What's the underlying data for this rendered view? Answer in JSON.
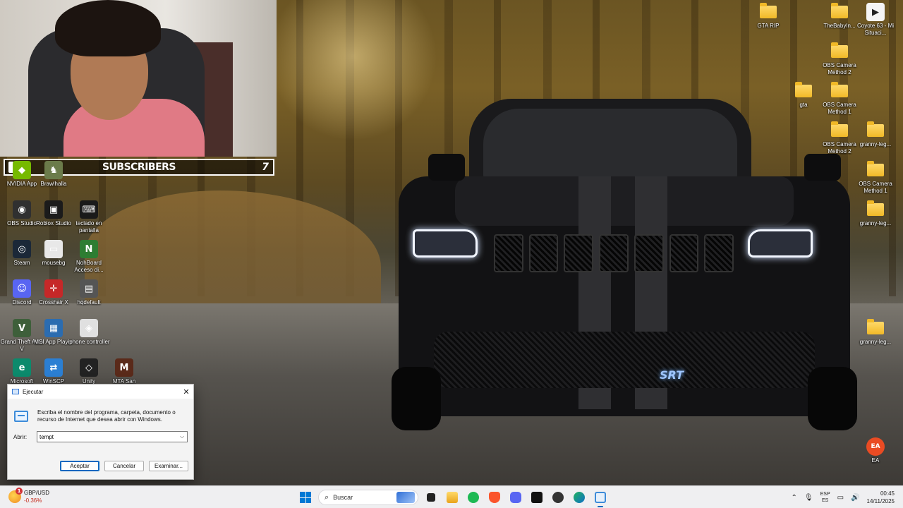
{
  "stream": {
    "subscribers_label": "SUBSCRIBERS",
    "subscribers_count": "7"
  },
  "desktop_left": [
    {
      "name": "nvidia-app",
      "label": "NVIDIA App",
      "color": "#76b900",
      "glyph": "◆"
    },
    {
      "name": "brawlhalla",
      "label": "Brawlhalla",
      "color": "#6b7b4a",
      "glyph": "♞"
    },
    {
      "name": "obs-studio",
      "label": "OBS Studio",
      "color": "#303030",
      "glyph": "◉"
    },
    {
      "name": "roblox-studio",
      "label": "Roblox Studio",
      "color": "#1b1b1b",
      "glyph": "▣"
    },
    {
      "name": "teclado-en-pantalla",
      "label": "teclado en pantalla",
      "color": "#1a1a1a",
      "glyph": "⌨"
    },
    {
      "name": "steam",
      "label": "Steam",
      "color": "#1b2838",
      "glyph": "◎"
    },
    {
      "name": "mousebg",
      "label": "mousebg",
      "color": "#e8e8e8",
      "glyph": "▭"
    },
    {
      "name": "nohboard",
      "label": "NohBoard Acceso di...",
      "color": "#2e7d32",
      "glyph": "N"
    },
    {
      "name": "discord",
      "label": "Discord",
      "color": "#5865f2",
      "glyph": "☺"
    },
    {
      "name": "crosshair-x",
      "label": "Crosshair X",
      "color": "#c62828",
      "glyph": "✛"
    },
    {
      "name": "hqdefault",
      "label": "hqdefault",
      "color": "#555",
      "glyph": "▤"
    },
    {
      "name": "grand-theft-auto-v",
      "label": "Grand Theft Auto V",
      "color": "#3e5f3a",
      "glyph": "V"
    },
    {
      "name": "msi-app-player",
      "label": "MSI App Player",
      "color": "#2b6cb0",
      "glyph": "▦"
    },
    {
      "name": "iphone-controller",
      "label": "iphone controller",
      "color": "#e0e0e0",
      "glyph": "◈"
    },
    {
      "name": "microsoft-edge",
      "label": "Microsoft",
      "color": "#0c8a6c",
      "glyph": "e"
    },
    {
      "name": "winscp",
      "label": "WinSCP",
      "color": "#2b7fd3",
      "glyph": "⇄"
    },
    {
      "name": "unity",
      "label": "Unity",
      "color": "#222",
      "glyph": "◇"
    },
    {
      "name": "mta-san",
      "label": "MTA San",
      "color": "#5a2a1a",
      "glyph": "M"
    }
  ],
  "desktop_right": [
    {
      "name": "gta-rip",
      "label": "GTA RIP",
      "type": "folder"
    },
    {
      "name": "thebabyin",
      "label": "TheBabyIn...",
      "type": "folder"
    },
    {
      "name": "coyote-63",
      "label": "Coyote 63 - Mi Situaci...",
      "type": "media"
    },
    {
      "name": "obs-camera-method-2-a",
      "label": "OBS Camera Method 2",
      "type": "folder"
    },
    {
      "name": "gta",
      "label": "gta",
      "type": "folder"
    },
    {
      "name": "obs-camera-method-1-a",
      "label": "OBS Camera Method 1",
      "type": "folder"
    },
    {
      "name": "obs-camera-method-2-b",
      "label": "OBS Camera Method 2",
      "type": "folder"
    },
    {
      "name": "granny-leg-1",
      "label": "granny-leg...",
      "type": "folder"
    },
    {
      "name": "obs-camera-method-1-b",
      "label": "OBS Camera Method 1",
      "type": "folder"
    },
    {
      "name": "granny-leg-2",
      "label": "granny-leg...",
      "type": "folder"
    },
    {
      "name": "granny-leg-3",
      "label": "granny-leg...",
      "type": "folder"
    },
    {
      "name": "ea",
      "label": "EA",
      "type": "ea"
    }
  ],
  "run_dialog": {
    "title": "Ejecutar",
    "description": "Escriba el nombre del programa, carpeta, documento o recurso de Internet que desea abrir con Windows.",
    "open_label": "Abrir:",
    "input_value": "tempt",
    "ok_label": "Aceptar",
    "cancel_label": "Cancelar",
    "browse_label": "Examinar..."
  },
  "taskbar": {
    "weather_title": "GBP/USD",
    "weather_change": "-0.36%",
    "weather_badge": "1",
    "search_placeholder": "Buscar",
    "language_top": "ESP",
    "language_bottom": "ES",
    "time": "00:45",
    "date": "14/11/2025"
  },
  "car_badge": "SRT"
}
